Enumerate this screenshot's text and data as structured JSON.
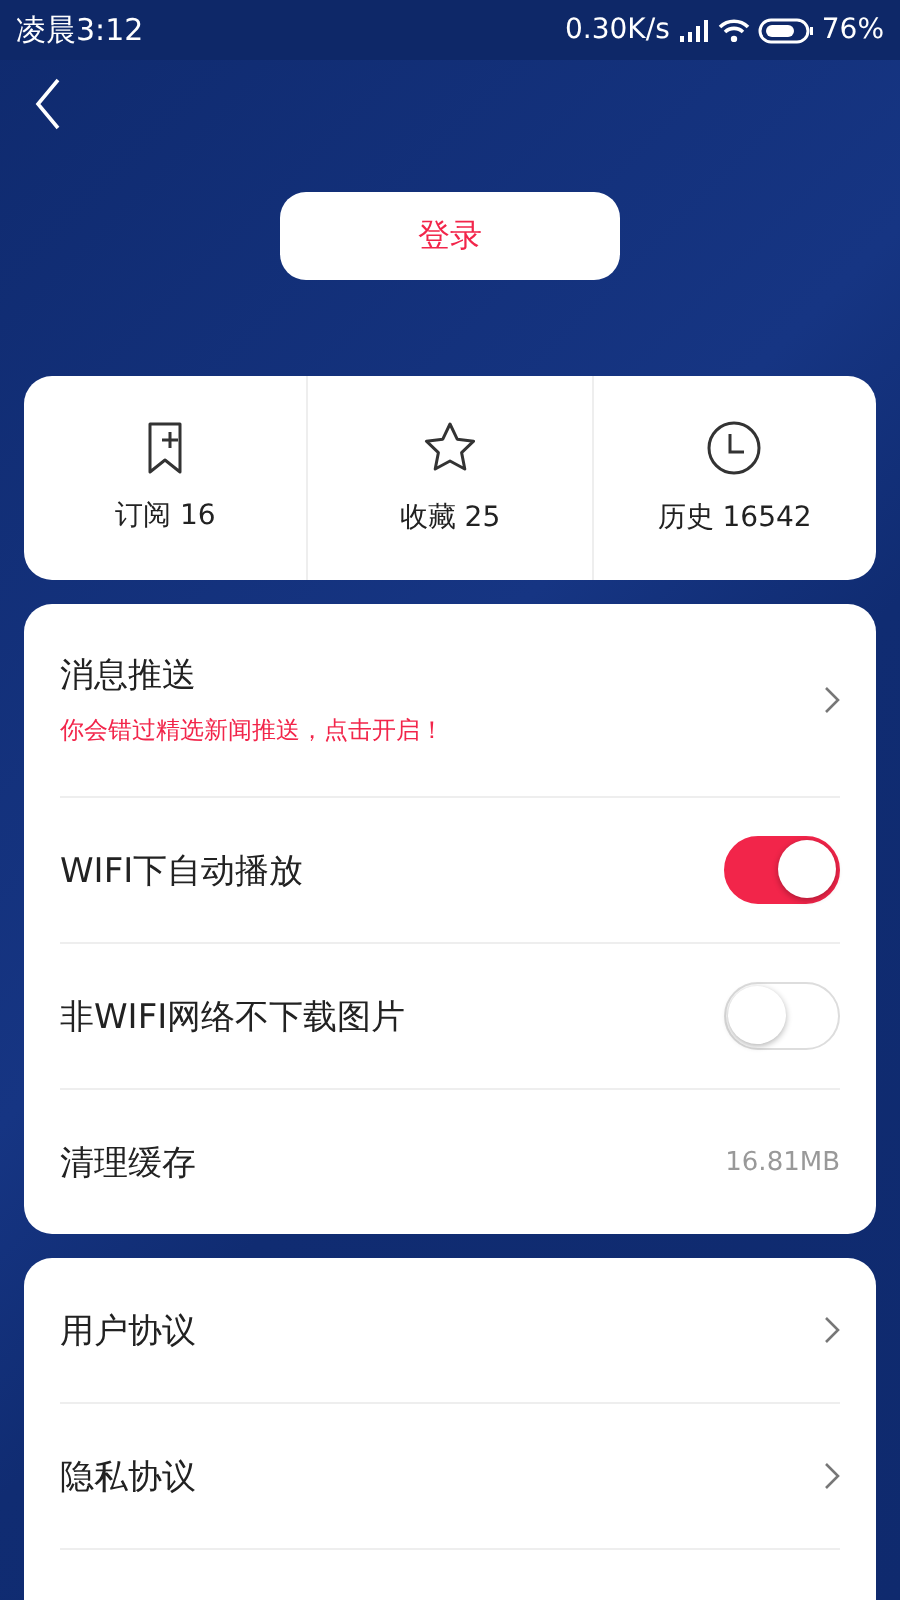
{
  "status_bar": {
    "time": "凌晨3:12",
    "speed": "0.30K/s",
    "battery": "76%"
  },
  "login_button": {
    "label": "登录"
  },
  "stats": [
    {
      "kind": "bookmark",
      "label": "订阅 16"
    },
    {
      "kind": "star",
      "label": "收藏 25"
    },
    {
      "kind": "clock",
      "label": "历史 16542"
    }
  ],
  "settings": [
    {
      "kind": "link",
      "label": "消息推送",
      "subtitle": "你会错过精选新闻推送，点击开启！"
    },
    {
      "kind": "toggle",
      "label": "WIFI下自动播放",
      "on": true
    },
    {
      "kind": "toggle",
      "label": "非WIFI网络不下载图片",
      "on": false
    },
    {
      "kind": "value",
      "label": "清理缓存",
      "value": "16.81MB"
    }
  ],
  "links": [
    {
      "kind": "link",
      "label": "用户协议"
    },
    {
      "kind": "link",
      "label": "隐私协议"
    },
    {
      "kind": "blank"
    }
  ]
}
